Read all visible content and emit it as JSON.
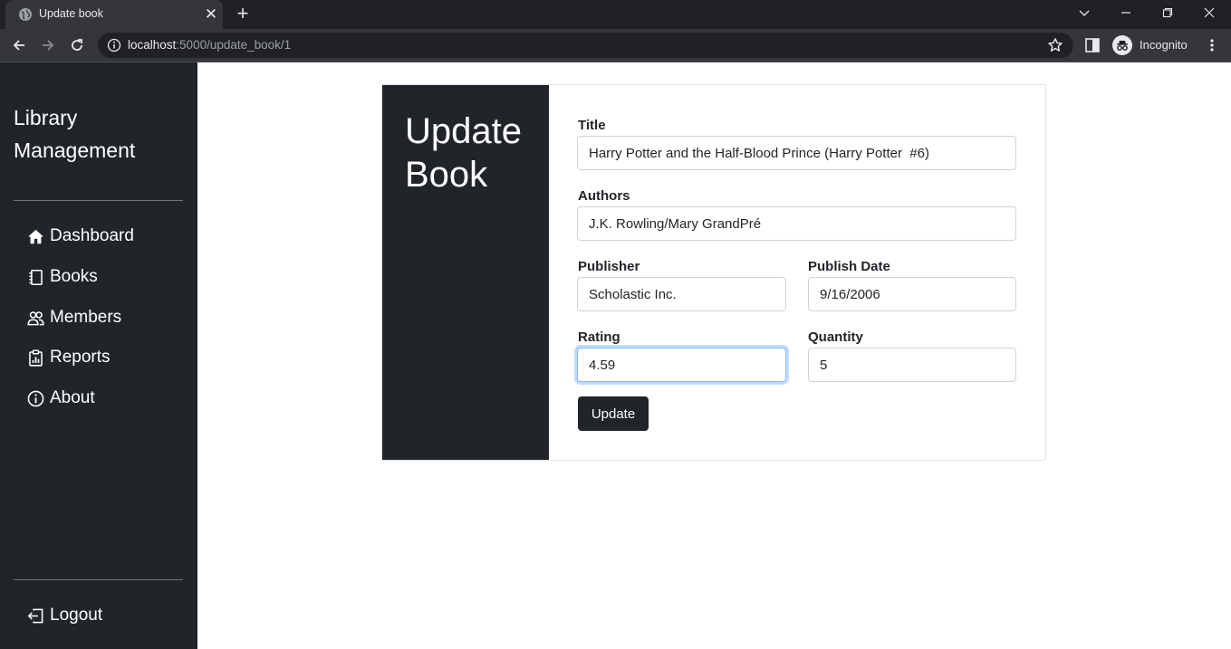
{
  "browser": {
    "tab_title": "Update book",
    "url_host": "localhost",
    "url_rest": ":5000/update_book/1",
    "profile_label": "Incognito"
  },
  "sidebar": {
    "brand": "Library Management",
    "items": [
      {
        "label": "Dashboard",
        "icon": "house-icon"
      },
      {
        "label": "Books",
        "icon": "journals-icon"
      },
      {
        "label": "Members",
        "icon": "people-icon"
      },
      {
        "label": "Reports",
        "icon": "clipboard-data-icon"
      },
      {
        "label": "About",
        "icon": "info-circle-icon"
      }
    ],
    "logout_label": "Logout"
  },
  "form": {
    "heading": "Update Book",
    "title_label": "Title",
    "title_value": "Harry Potter and the Half-Blood Prince (Harry Potter  #6)",
    "authors_label": "Authors",
    "authors_value": "J.K. Rowling/Mary GrandPré",
    "publisher_label": "Publisher",
    "publisher_value": "Scholastic Inc.",
    "publish_date_label": "Publish Date",
    "publish_date_value": "9/16/2006",
    "rating_label": "Rating",
    "rating_value": "4.59",
    "quantity_label": "Quantity",
    "quantity_value": "5",
    "submit_label": "Update"
  },
  "colors": {
    "sidebar_bg": "#212529",
    "chrome_bg": "#202124",
    "focus_border": "#86b7fe"
  }
}
